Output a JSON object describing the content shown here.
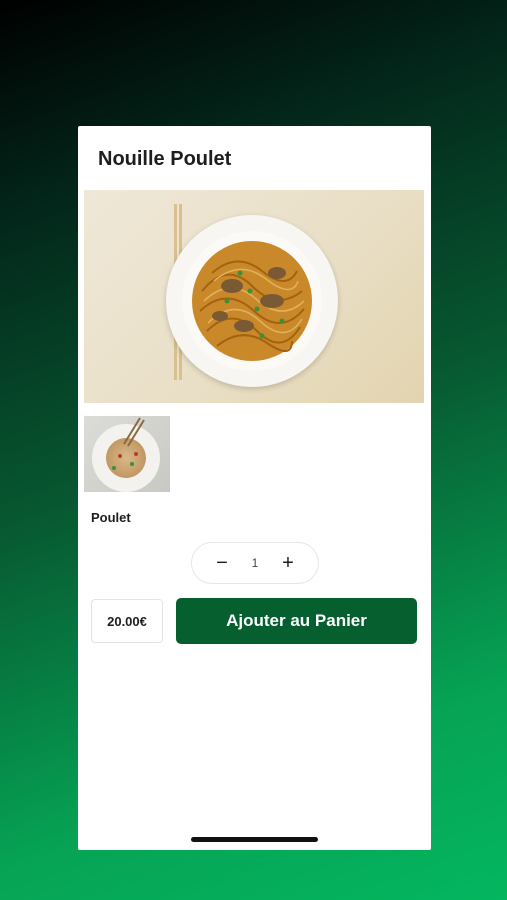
{
  "product": {
    "title": "Nouille Poulet",
    "hero_image": "noodle-dish-photo",
    "thumbnail_image": "noodle-dish-thumbnail"
  },
  "variant": {
    "label": "Poulet"
  },
  "quantity": {
    "decrement_symbol": "−",
    "value": "1",
    "increment_symbol": "+"
  },
  "price": {
    "label": "20.00€"
  },
  "actions": {
    "add_to_cart_label": "Ajouter au Panier"
  },
  "colors": {
    "accent": "#055f2e",
    "background_top": "#000000",
    "background_bottom": "#04b65f"
  }
}
